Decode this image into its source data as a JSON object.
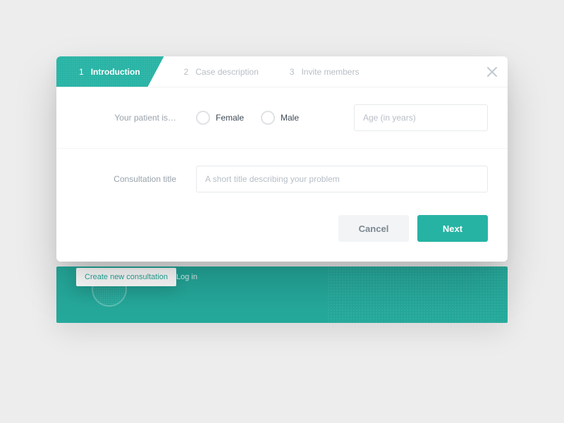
{
  "steps": [
    {
      "num": "1",
      "label": "Introduction"
    },
    {
      "num": "2",
      "label": "Case description"
    },
    {
      "num": "3",
      "label": "Invite members"
    }
  ],
  "form": {
    "patient_label": "Your patient is…",
    "gender_options": {
      "female": "Female",
      "male": "Male"
    },
    "age_placeholder": "Age (in years)",
    "title_label": "Consultation title",
    "title_placeholder": "A short title describing your problem"
  },
  "buttons": {
    "cancel": "Cancel",
    "next": "Next"
  },
  "background": {
    "create": "Create new consultation",
    "login": "Log in"
  }
}
